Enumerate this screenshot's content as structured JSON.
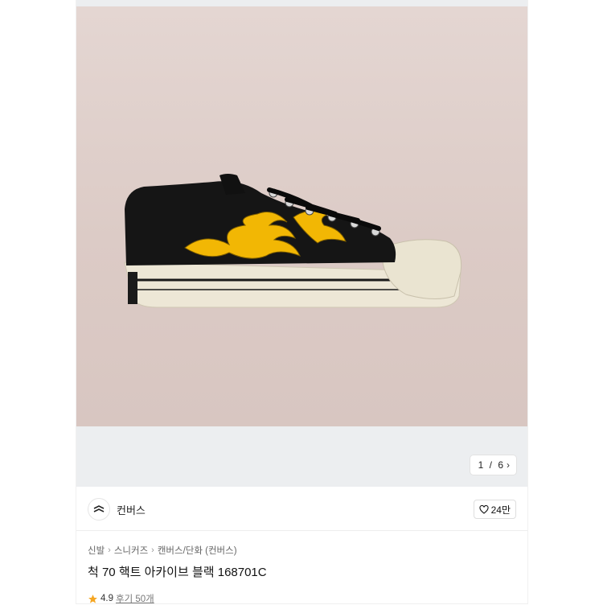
{
  "gallery": {
    "current": "1",
    "total": "6",
    "separator": " / ",
    "next_icon": "chevron-right-icon"
  },
  "brand": {
    "name": "컨버스",
    "logo_icon": "converse-star-chevron-icon"
  },
  "like": {
    "count": "24만",
    "icon": "heart-outline-icon"
  },
  "breadcrumb": [
    "신발",
    "스니커즈",
    "캔버스/단화 (컨버스)"
  ],
  "product": {
    "title": "척 70 핵트 아카이브 블랙 168701C"
  },
  "rating": {
    "score": "4.9",
    "review_label": "후기 50개",
    "star_color": "#f5a623"
  },
  "colors": {
    "shoe_body": "#141414",
    "flame": "#f2b704",
    "sole": "#efeadb",
    "background": "#decdc8"
  }
}
